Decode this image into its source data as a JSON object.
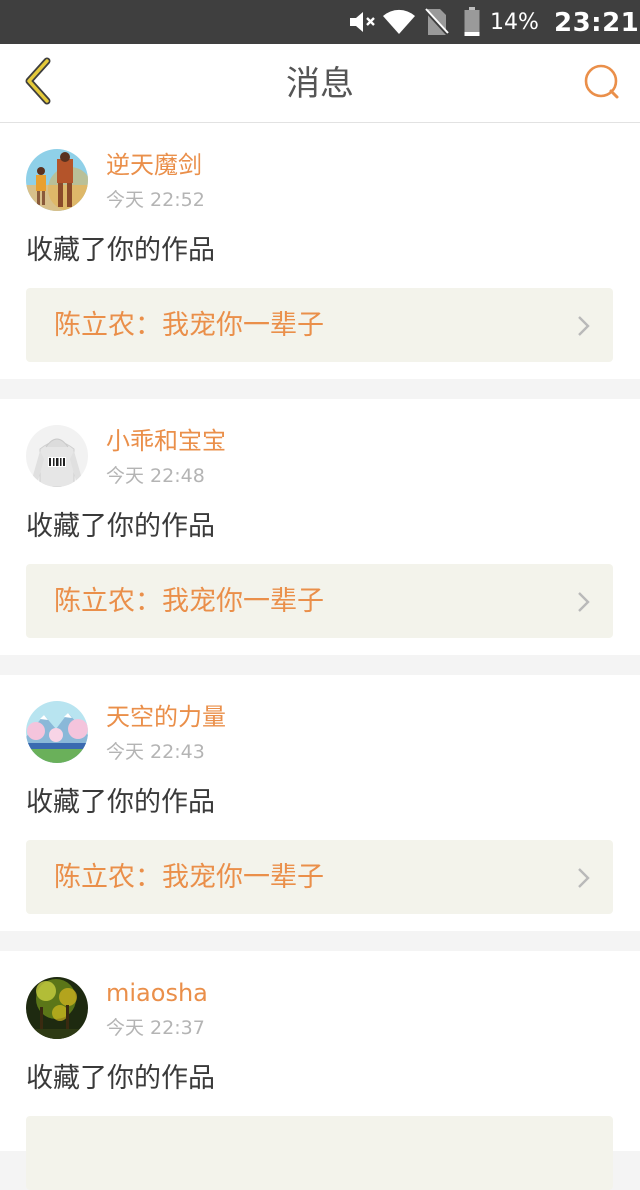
{
  "status_bar": {
    "battery_percent": "14%",
    "time": "23:21",
    "icons": [
      "mute-icon",
      "wifi-icon",
      "no-sim-icon",
      "battery-icon"
    ]
  },
  "header": {
    "title": "消息",
    "back_icon": "chevron-left-icon",
    "search_icon": "search-icon"
  },
  "colors": {
    "accent": "#ea8f4a",
    "back_icon": "#c7ac2c",
    "link_card_bg": "#f3f3eb",
    "status_bar_bg": "#3f3f3f"
  },
  "messages": [
    {
      "username": "逆天魔剑",
      "time": "今天 22:52",
      "action": "收藏了你的作品",
      "work": "陈立农：我宠你一辈子"
    },
    {
      "username": "小乖和宝宝",
      "time": "今天 22:48",
      "action": "收藏了你的作品",
      "work": "陈立农：我宠你一辈子"
    },
    {
      "username": "天空的力量",
      "time": "今天 22:43",
      "action": "收藏了你的作品",
      "work": "陈立农：我宠你一辈子"
    },
    {
      "username": "miaosha",
      "time": "今天 22:37",
      "action": "收藏了你的作品",
      "work": ""
    }
  ]
}
